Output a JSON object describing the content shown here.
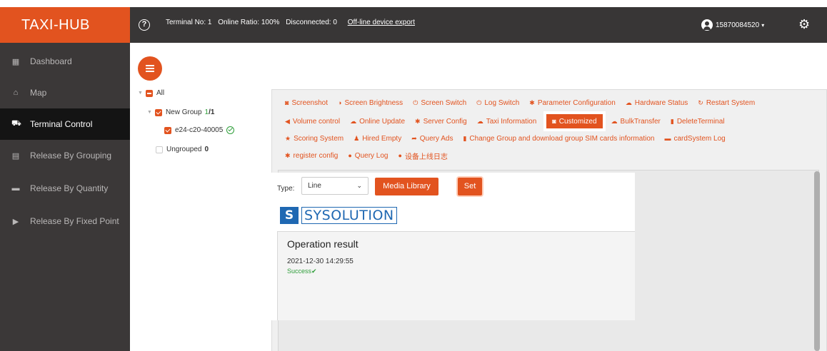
{
  "header": {
    "brand": "TAXI-HUB",
    "help_icon": "?",
    "terminal_no": "Terminal No: 1",
    "online_ratio": "Online Ratio: 100%",
    "disconnected": "Disconnected: 0",
    "export_link": "Off-line device export",
    "user": "15870084520",
    "caret": "▾",
    "gear_icon": "⚙"
  },
  "sidebar": {
    "items": [
      {
        "label": "Dashboard",
        "icon": "dashboard-icon",
        "glyph": "▦"
      },
      {
        "label": "Map",
        "icon": "map-icon",
        "glyph": "⌂"
      },
      {
        "label": "Terminal Control",
        "icon": "car-icon",
        "glyph": "⛟"
      },
      {
        "label": "Release By Grouping",
        "icon": "grouping-icon",
        "glyph": "▤"
      },
      {
        "label": "Release By Quantity",
        "icon": "quantity-icon",
        "glyph": "▬"
      },
      {
        "label": "Release By Fixed Point",
        "icon": "play-icon",
        "glyph": "▶"
      }
    ]
  },
  "tree": {
    "all_label": "All",
    "group_label": "New Group",
    "group_count": "1",
    "group_total": "/1",
    "device_label": "e24-c20-40005",
    "ungrouped_label": "Ungrouped",
    "ungrouped_count": "0"
  },
  "toolbar": {
    "row1": [
      {
        "label": "Screenshot",
        "glyph": "◙"
      },
      {
        "label": "Screen Brightness",
        "glyph": "◑"
      },
      {
        "label": "Screen Switch",
        "glyph": "⏻"
      },
      {
        "label": "Log Switch",
        "glyph": "⏻"
      },
      {
        "label": "Parameter Configuration",
        "glyph": "✱"
      },
      {
        "label": "Hardware Status",
        "glyph": "☁"
      },
      {
        "label": "Restart System",
        "glyph": "↻"
      }
    ],
    "row2": [
      {
        "label": "Volume control",
        "glyph": "◀"
      },
      {
        "label": "Online Update",
        "glyph": "☁"
      },
      {
        "label": "Server Config",
        "glyph": "✱"
      },
      {
        "label": "Taxi Information",
        "glyph": "☁"
      },
      {
        "label": "Customized",
        "glyph": "◙"
      },
      {
        "label": "BulkTransfer",
        "glyph": "☁"
      },
      {
        "label": "DeleteTerminal",
        "glyph": "▮"
      }
    ],
    "row3": [
      {
        "label": "Scoring System",
        "glyph": "★"
      },
      {
        "label": "Hired Empty",
        "glyph": "♟"
      },
      {
        "label": "Query Ads",
        "glyph": "➦"
      },
      {
        "label": "Change Group and download group SIM cards information",
        "glyph": "▮"
      },
      {
        "label": "cardSystem Log",
        "glyph": "▬"
      }
    ],
    "row4": [
      {
        "label": "register config",
        "glyph": "✱"
      },
      {
        "label": "Query Log",
        "glyph": "●"
      },
      {
        "label": "设备上线日志",
        "glyph": "●"
      }
    ]
  },
  "form": {
    "type_label": "Type:",
    "type_value": "Line",
    "type_caret": "⌄",
    "media_button": "Media Library",
    "set_button": "Set"
  },
  "logo": {
    "mark": "S",
    "text": "SYSOLUTION"
  },
  "result": {
    "title": "Operation result",
    "time": "2021-12-30 14:29:55",
    "status": "Success✔"
  }
}
